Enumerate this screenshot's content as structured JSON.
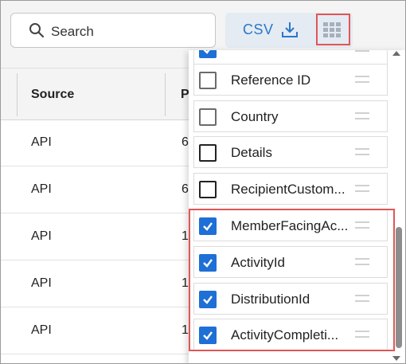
{
  "toolbar": {
    "search_placeholder": "Search",
    "csv_label": "CSV",
    "icons": {
      "search": "search-icon",
      "download": "download-icon",
      "columns": "grid-icon"
    }
  },
  "table": {
    "headers": {
      "source": "Source",
      "second": "P"
    },
    "rows": [
      {
        "source": "API",
        "second": "6"
      },
      {
        "source": "API",
        "second": "6"
      },
      {
        "source": "API",
        "second": "1"
      },
      {
        "source": "API",
        "second": "1"
      },
      {
        "source": "API",
        "second": "1"
      }
    ]
  },
  "column_chooser": {
    "items": [
      {
        "label": "",
        "checked": true
      },
      {
        "label": "Reference ID",
        "checked": false
      },
      {
        "label": "Country",
        "checked": false
      },
      {
        "label": "Details",
        "checked": false
      },
      {
        "label": "RecipientCustom...",
        "checked": false
      },
      {
        "label": "MemberFacingAc...",
        "checked": true
      },
      {
        "label": "ActivityId",
        "checked": true
      },
      {
        "label": "DistributionId",
        "checked": true
      },
      {
        "label": "ActivityCompleti...",
        "checked": true
      }
    ]
  },
  "colors": {
    "accent": "#2a78c8",
    "checkbox_checked": "#1e6fd6",
    "highlight": "#e05656",
    "toolbar_bg": "#f4f4f4",
    "button_bg": "#e4ebf3"
  }
}
